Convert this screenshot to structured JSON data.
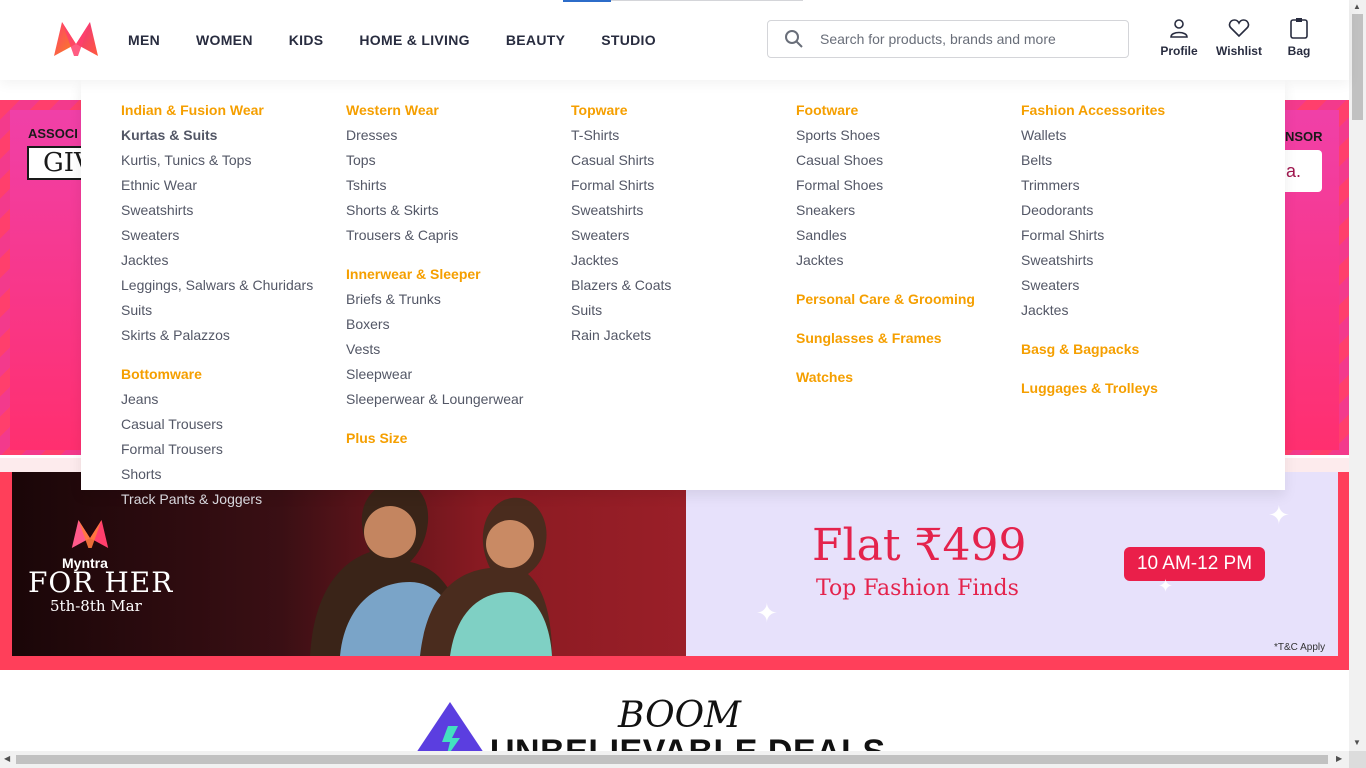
{
  "header": {
    "nav": [
      "MEN",
      "WOMEN",
      "KIDS",
      "HOME & LIVING",
      "BEAUTY",
      "STUDIO"
    ],
    "search_placeholder": "Search for products, brands and more",
    "actions": [
      {
        "label": "Profile",
        "icon": "person-icon"
      },
      {
        "label": "Wishlist",
        "icon": "heart-icon"
      },
      {
        "label": "Bag",
        "icon": "bag-icon"
      }
    ]
  },
  "mega_menu": {
    "col1": {
      "cat1": "Indian & Fusion Wear",
      "items1": [
        "Kurtas & Suits",
        "Kurtis, Tunics & Tops",
        "Ethnic Wear",
        "Sweatshirts",
        "Sweaters",
        "Jacktes",
        "Leggings, Salwars & Churidars",
        "Suits",
        "Skirts & Palazzos"
      ],
      "cat2": "Bottomware",
      "items2": [
        "Jeans",
        "Casual Trousers",
        "Formal Trousers",
        "Shorts"
      ],
      "overflow": "Track Pants & Joggers"
    },
    "col2": {
      "cat1": "Western Wear",
      "items1": [
        "Dresses",
        "Tops",
        "Tshirts",
        "Shorts & Skirts",
        "Trousers & Capris"
      ],
      "cat2": "Innerwear & Sleeper",
      "items2": [
        "Briefs & Trunks",
        "Boxers",
        "Vests",
        "Sleepwear",
        "Sleeperwear & Loungerwear"
      ],
      "cat3": "Plus Size"
    },
    "col3": {
      "cat1": "Topware",
      "items1": [
        "T-Shirts",
        "Casual Shirts",
        "Formal Shirts",
        "Sweatshirts",
        "Sweaters",
        "Jacktes",
        "Blazers & Coats",
        "Suits",
        "Rain Jackets"
      ]
    },
    "col4": {
      "cat1": "Footware",
      "items1": [
        "Sports Shoes",
        "Casual Shoes",
        "Formal Shoes",
        "Sneakers",
        "Sandles",
        "Jacktes"
      ],
      "cat2": "Personal Care & Grooming",
      "cat3": "Sunglasses & Frames",
      "cat4": "Watches"
    },
    "col5": {
      "cat1": "Fashion Accessorites",
      "items1": [
        "Wallets",
        "Belts",
        "Trimmers",
        "Deodorants",
        "Formal Shirts",
        "Sweatshirts",
        "Sweaters",
        "Jacktes"
      ],
      "cat2": "Basg & Bagpacks",
      "cat3": "Luggages & Trolleys"
    }
  },
  "banners": {
    "assoc_label": "ASSOCI",
    "assoc_logo_text": "GIV",
    "sponsor_label": "NSOR",
    "sponsor_logo_text": "ia.",
    "her_brand": "Myntra",
    "her_title": "FOR HER",
    "her_dates": "5th-8th Mar",
    "flat": "Flat ₹499",
    "finds": "Top Fashion Finds",
    "time": "10 AM-12 PM",
    "tnc": "*T&C Apply",
    "boom": "BOOM",
    "unbelievable": "UNBELIEVABLE DEALS"
  },
  "colors": {
    "accent": "#f59f00",
    "brand_pink": "#ff3f6c",
    "text": "#282c3f",
    "link": "#535766"
  }
}
